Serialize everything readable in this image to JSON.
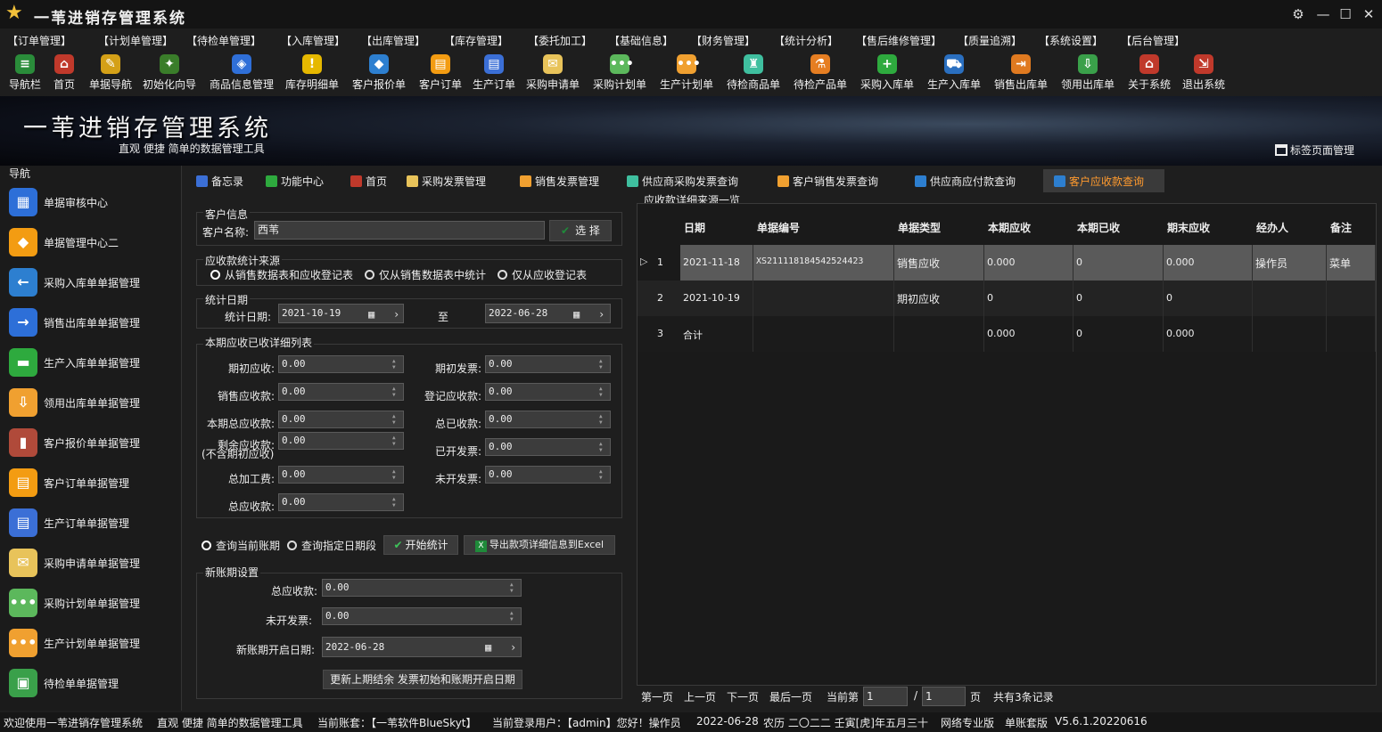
{
  "app": {
    "title": "一苇进销存管理系统"
  },
  "menu": [
    "【订单管理】",
    "【计划单管理】",
    "【待检单管理】",
    "【入库管理】",
    "【出库管理】",
    "【库存管理】",
    "【委托加工】",
    "【基础信息】",
    "【财务管理】",
    "【统计分析】",
    "【售后维修管理】",
    "【质量追溯】",
    "【系统设置】",
    "【后台管理】"
  ],
  "toolbar": [
    "导航栏",
    "首页",
    "单据导航",
    "初始化向导",
    "商品信息管理",
    "库存明细单",
    "客户报价单",
    "客户订单",
    "生产订单",
    "采购申请单",
    "采购计划单",
    "生产计划单",
    "待检商品单",
    "待检产品单",
    "采购入库单",
    "生产入库单",
    "销售出库单",
    "领用出库单",
    "关于系统",
    "退出系统"
  ],
  "banner": {
    "title": "一苇进销存管理系统",
    "subtitle": "直观 便捷 简单的数据管理工具",
    "tag_manage": "标签页面管理"
  },
  "sidebar": {
    "title": "导航",
    "items": [
      "单据审核中心",
      "单据管理中心二",
      "采购入库单单据管理",
      "销售出库单单据管理",
      "生产入库单单据管理",
      "领用出库单单据管理",
      "客户报价单单据管理",
      "客户订单单据管理",
      "生产订单单据管理",
      "采购申请单单据管理",
      "采购计划单单据管理",
      "生产计划单单据管理",
      "待检单单据管理"
    ]
  },
  "tabs": [
    "备忘录",
    "功能中心",
    "首页",
    "采购发票管理",
    "销售发票管理",
    "供应商采购发票查询",
    "客户销售发票查询",
    "供应商应付款查询",
    "客户应收款查询"
  ],
  "form": {
    "customer_group": "客户信息",
    "customer_label": "客户名称:",
    "customer_value": "西苇",
    "select_btn": "选 择",
    "source_group": "应收款统计来源",
    "source_opts": [
      "从销售数据表和应收登记表",
      "仅从销售数据表中统计",
      "仅从应收登记表"
    ],
    "date_group": "统计日期",
    "date_label": "统计日期:",
    "date_from": "2021-10-19",
    "to": "至",
    "date_to": "2022-06-28",
    "detail_group": "本期应收已收详细列表",
    "left_labels": [
      "期初应收:",
      "销售应收款:",
      "本期总应收款:",
      "剩余应收款:",
      "(不含期初应收)",
      "总加工费:",
      "总应收款:"
    ],
    "left_values": [
      "0.00",
      "0.00",
      "0.00",
      "0.00",
      "0.00",
      "0.00"
    ],
    "right_labels": [
      "期初发票:",
      "登记应收款:",
      "总已收款:",
      "已开发票:",
      "未开发票:"
    ],
    "right_values": [
      "0.00",
      "0.00",
      "0.00",
      "0.00",
      "0.00"
    ],
    "query_opts": [
      "查询当前账期",
      "查询指定日期段"
    ],
    "start_btn": "开始统计",
    "export_btn": "导出款项详细信息到Excel",
    "new_group": "新账期设置",
    "new_total_label": "总应收款:",
    "new_total": "0.00",
    "new_uninv_label": "未开发票:",
    "new_uninv": "0.00",
    "new_date_label": "新账期开启日期:",
    "new_date": "2022-06-28",
    "update_btn": "更新上期结余 发票初始和账期开启日期"
  },
  "grid": {
    "title": "应收款详细来源一览",
    "headers": [
      "日期",
      "单据编号",
      "单据类型",
      "本期应收",
      "本期已收",
      "期末应收",
      "经办人",
      "备注"
    ],
    "rows": [
      {
        "n": "1",
        "c": [
          "2021-11-18",
          "XS211118184542524423",
          "销售应收",
          "0.000",
          "0",
          "0.000",
          "操作员",
          "菜单"
        ]
      },
      {
        "n": "2",
        "c": [
          "2021-10-19",
          "",
          "期初应收",
          "0",
          "0",
          "0",
          "",
          ""
        ]
      },
      {
        "n": "3",
        "c": [
          "合计",
          "",
          "",
          "0.000",
          "0",
          "0.000",
          "",
          ""
        ]
      }
    ]
  },
  "pager": {
    "first": "第一页",
    "prev": "上一页",
    "next": "下一页",
    "last": "最后一页",
    "current_label": "当前第",
    "current": "1",
    "sep": "/",
    "total_pages": "1",
    "page_unit": "页",
    "total": "共有3条记录"
  },
  "status": [
    "欢迎使用一苇进销存管理系统",
    "直观 便捷 简单的数据管理工具",
    "当前账套：【一苇软件BlueSkyt】",
    "当前登录用户：【admin】您好！操作员",
    "2022-06-28",
    "农历 二〇二二 壬寅[虎]年五月三十",
    "网络专业版",
    "单账套版",
    "V5.6.1.20220616"
  ],
  "colors": {
    "accent": "#ff9a2e",
    "bg": "#1e1e1e",
    "selected_row": "#5a5a5a"
  }
}
